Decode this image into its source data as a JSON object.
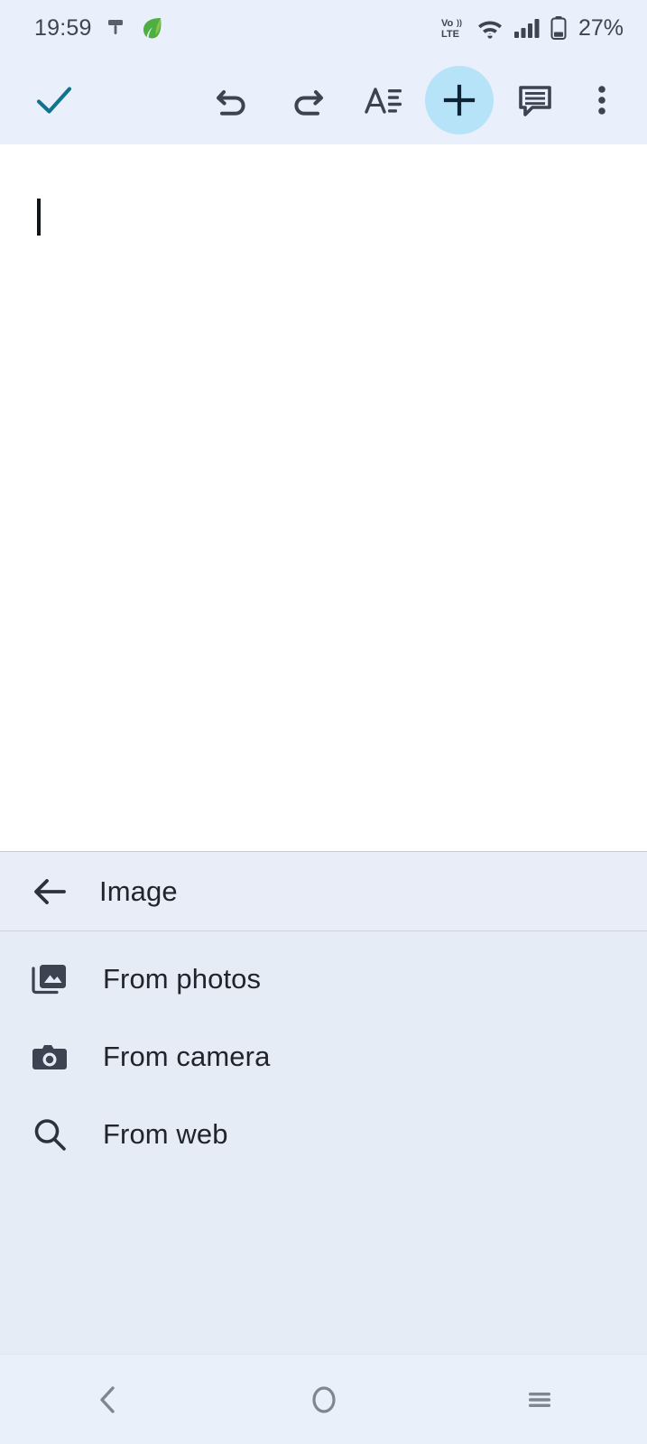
{
  "status_bar": {
    "time": "19:59",
    "battery_percent": "27%",
    "icons": {
      "pin": "pin-icon",
      "leaf": "leaf-icon",
      "volte": "volte-icon",
      "wifi": "wifi-icon",
      "signal": "signal-bars-icon",
      "battery": "battery-icon"
    },
    "background": "#e9effb",
    "text_color": "#3d4552"
  },
  "toolbar": {
    "background": "#e9effb",
    "accept_label": "done-check",
    "accept_color": "#0f7490",
    "undo_label": "undo",
    "redo_label": "redo",
    "format_label": "format-text",
    "insert_label": "insert",
    "insert_active": true,
    "insert_highlight_color": "#b6e3f7",
    "comment_label": "comment",
    "more_label": "more-options",
    "icon_color": "#3c4451"
  },
  "document": {
    "body_text": "",
    "cursor_visible": true,
    "background": "#ffffff"
  },
  "sheet": {
    "background": "#e6ecf6",
    "header": {
      "back_label": "back",
      "title": "Image"
    },
    "items": [
      {
        "icon": "photo-library-icon",
        "label": "From photos"
      },
      {
        "icon": "camera-icon",
        "label": "From camera"
      },
      {
        "icon": "search-icon",
        "label": "From web"
      }
    ]
  },
  "navbar": {
    "background": "#eaf0fa",
    "icon_color": "#7e8791",
    "back_label": "back",
    "home_label": "home",
    "recents_label": "recents"
  }
}
